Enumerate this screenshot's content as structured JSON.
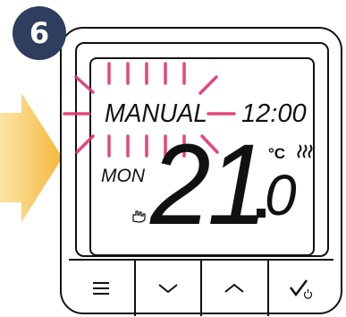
{
  "step": {
    "number": "6"
  },
  "display": {
    "mode": "MANUAL",
    "time": "12:00",
    "day": "MON",
    "temperature_int": "21",
    "temperature_frac": "0",
    "unit": "°C"
  },
  "icons": {
    "heating": "heating-waves-icon",
    "manual": "hand-icon"
  },
  "buttons": [
    {
      "name": "menu",
      "icon": "menu-icon"
    },
    {
      "name": "down",
      "icon": "chevron-down-icon"
    },
    {
      "name": "up",
      "icon": "chevron-up-icon"
    },
    {
      "name": "confirm",
      "icon": "check-power-icon"
    }
  ],
  "colors": {
    "badge": "#2f3d5e",
    "blink_rays": "#e0346c",
    "arrow": "#f4b73c"
  }
}
